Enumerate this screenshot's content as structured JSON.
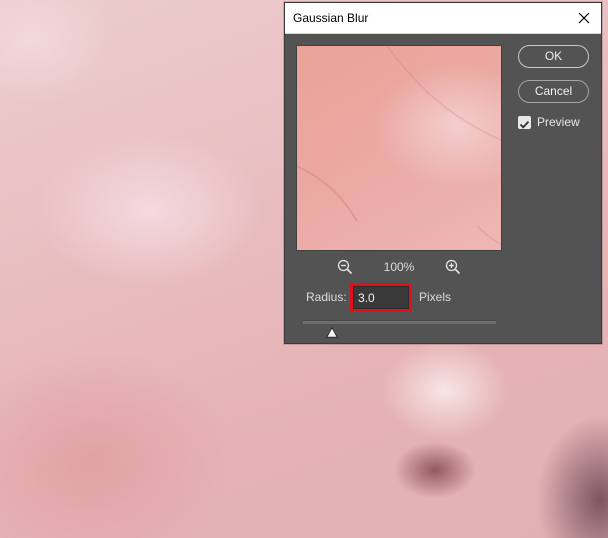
{
  "dialog": {
    "title": "Gaussian Blur",
    "ok_label": "OK",
    "cancel_label": "Cancel",
    "preview_label": "Preview",
    "preview_checked": true,
    "zoom_level": "100%",
    "radius": {
      "label": "Radius:",
      "value": "3.0",
      "unit": "Pixels"
    },
    "slider_fraction": 0.15
  },
  "icons": {
    "close": "close-icon",
    "zoom_out": "zoom-out-icon",
    "zoom_in": "zoom-in-icon",
    "checkbox": "checkmark-icon"
  },
  "colors": {
    "dialog_bg": "#535353",
    "highlight": "#e0101a",
    "titlebar": "#ffffff"
  }
}
